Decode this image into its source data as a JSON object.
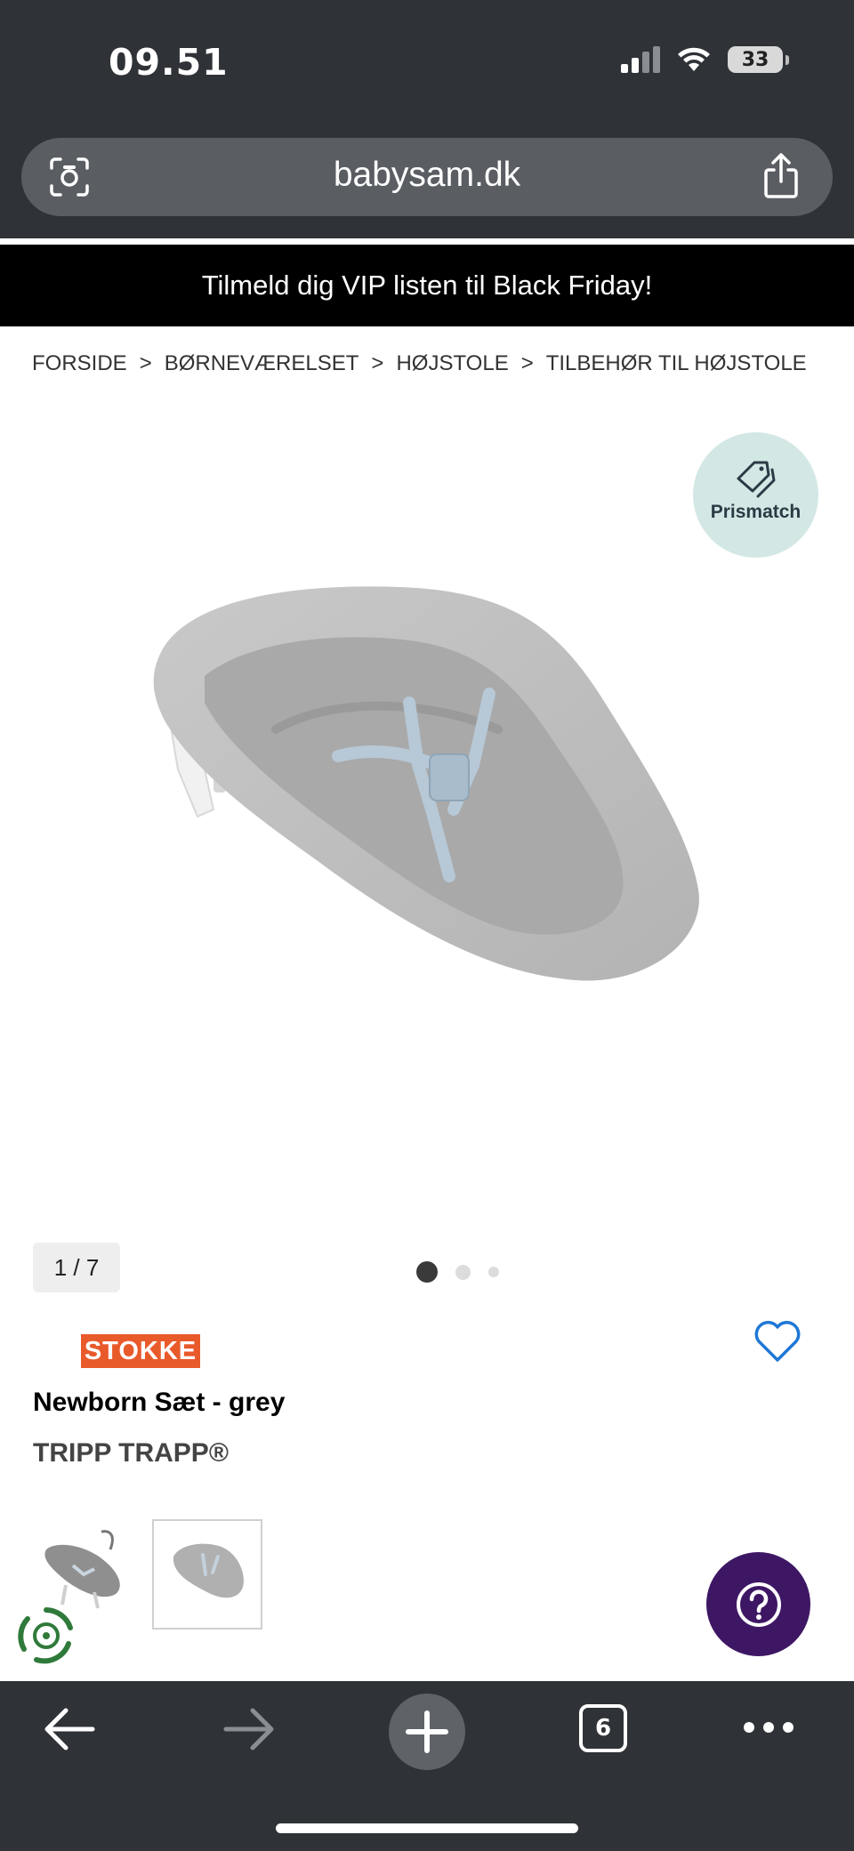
{
  "status_bar": {
    "time": "09.51",
    "battery": "33"
  },
  "browser": {
    "url": "babysam.dk",
    "tab_count": "6"
  },
  "promo_banner": {
    "text": "Tilmeld dig VIP listen til Black Friday!"
  },
  "breadcrumb": {
    "items": [
      "FORSIDE",
      "BØRNEVÆRELSET",
      "HØJSTOLE",
      "TILBEHØR TIL HØJSTOLE"
    ],
    "separator": ">"
  },
  "prismatch": {
    "label": "Prismatch"
  },
  "gallery": {
    "counter": "1 / 7",
    "active_dot": 1,
    "dot_count": 3
  },
  "product": {
    "brand": "STOKKE",
    "name": "Newborn Sæt - grey",
    "series": "TRIPP TRAPP®"
  },
  "colors": {
    "browser_chrome": "#2f3237",
    "promo_background": "#000000",
    "prismatch_background": "#d3e8e5",
    "brand_orange": "#e95a2b",
    "help_button": "#3e1764",
    "wishlist_blue": "#1e78d6"
  },
  "icons": {
    "camera": "camera-search-icon",
    "share": "share-icon",
    "prismatch": "price-tag-icon",
    "wishlist": "heart-icon",
    "help": "question-mark-icon",
    "recycle": "recycle-icon",
    "back": "arrow-left-icon",
    "forward": "arrow-right-icon",
    "new_tab": "plus-icon",
    "tabs": "tabs-icon",
    "more": "more-dots-icon"
  }
}
